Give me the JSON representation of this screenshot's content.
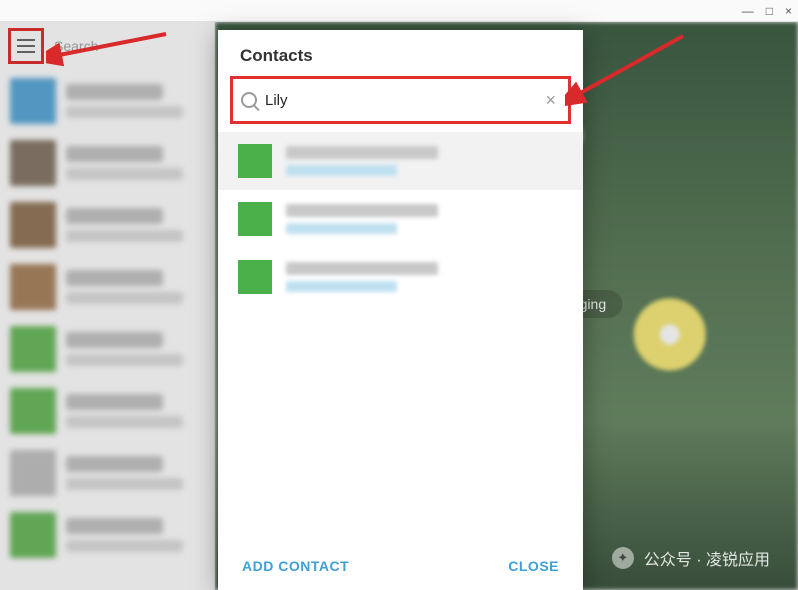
{
  "window": {
    "minimize": "—",
    "maximize": "□",
    "close": "×"
  },
  "sidebar": {
    "search_placeholder": "Search",
    "items": [
      {},
      {},
      {},
      {},
      {},
      {},
      {},
      {}
    ]
  },
  "main": {
    "hint_label": "Select a chat to start messaging"
  },
  "modal": {
    "title": "Contacts",
    "search_value": "Lily",
    "clear_label": "×",
    "results": [
      {
        "name": "———",
        "status": "last seen ———"
      },
      {
        "name": "———",
        "status": "———"
      },
      {
        "name": "———",
        "status": "———"
      }
    ],
    "add_contact_label": "ADD CONTACT",
    "close_label": "CLOSE"
  },
  "watermark": {
    "text": "公众号 · 凌锐应用"
  },
  "colors": {
    "accent": "#3fa0d6",
    "highlight_border": "#e03030",
    "avatar_green": "#49b04a"
  }
}
